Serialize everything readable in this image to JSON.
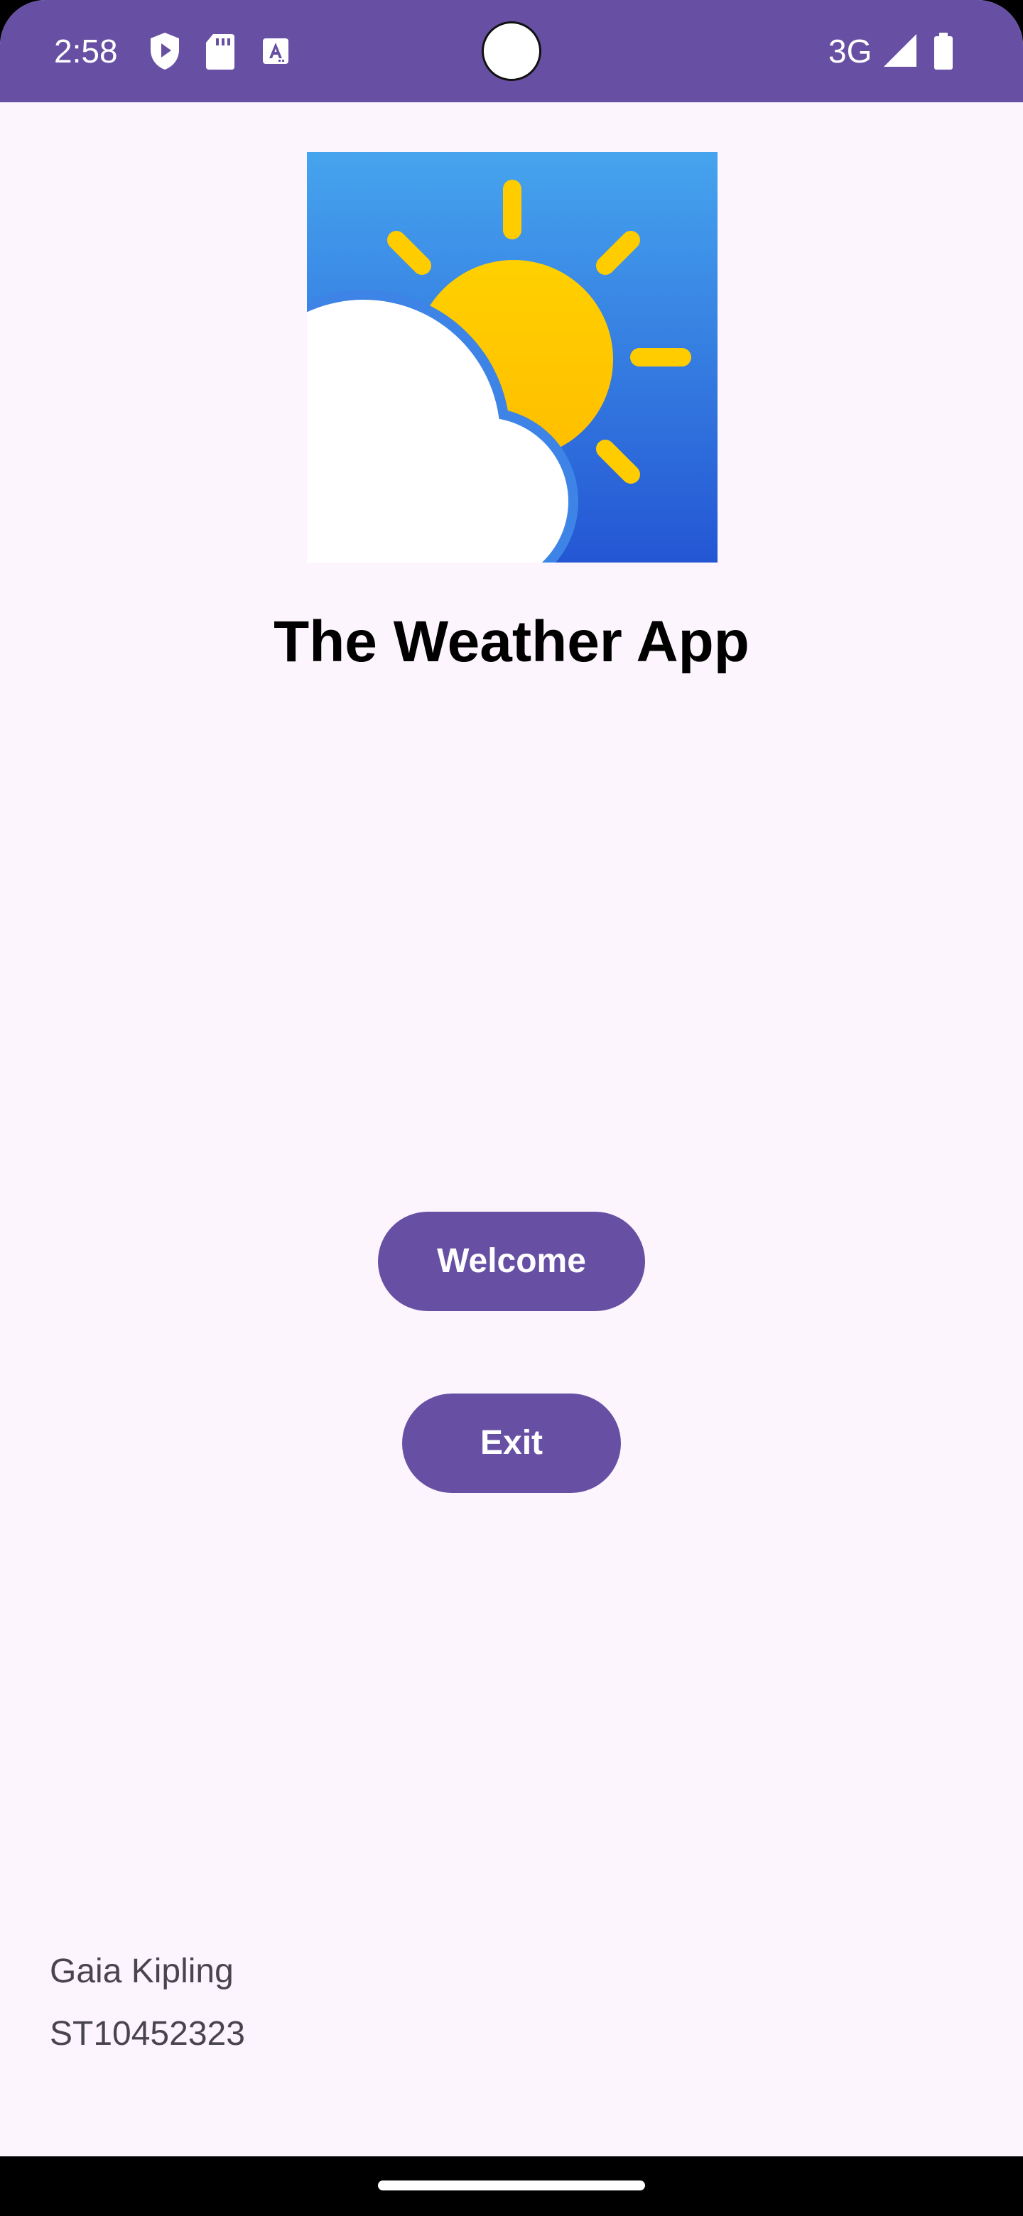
{
  "status_bar": {
    "time": "2:58",
    "network": "3G",
    "color": "#6750a4",
    "icons": [
      "shield-play-icon",
      "sd-card-icon",
      "keyboard-a-icon",
      "signal-icon",
      "battery-icon"
    ]
  },
  "logo": {
    "icon": "weather-sun-cloud-icon"
  },
  "title": "The Weather App",
  "buttons": {
    "welcome": "Welcome",
    "exit": "Exit",
    "color": "#6750a4"
  },
  "footer": {
    "name": "Gaia Kipling",
    "student_id": "ST10452323"
  }
}
